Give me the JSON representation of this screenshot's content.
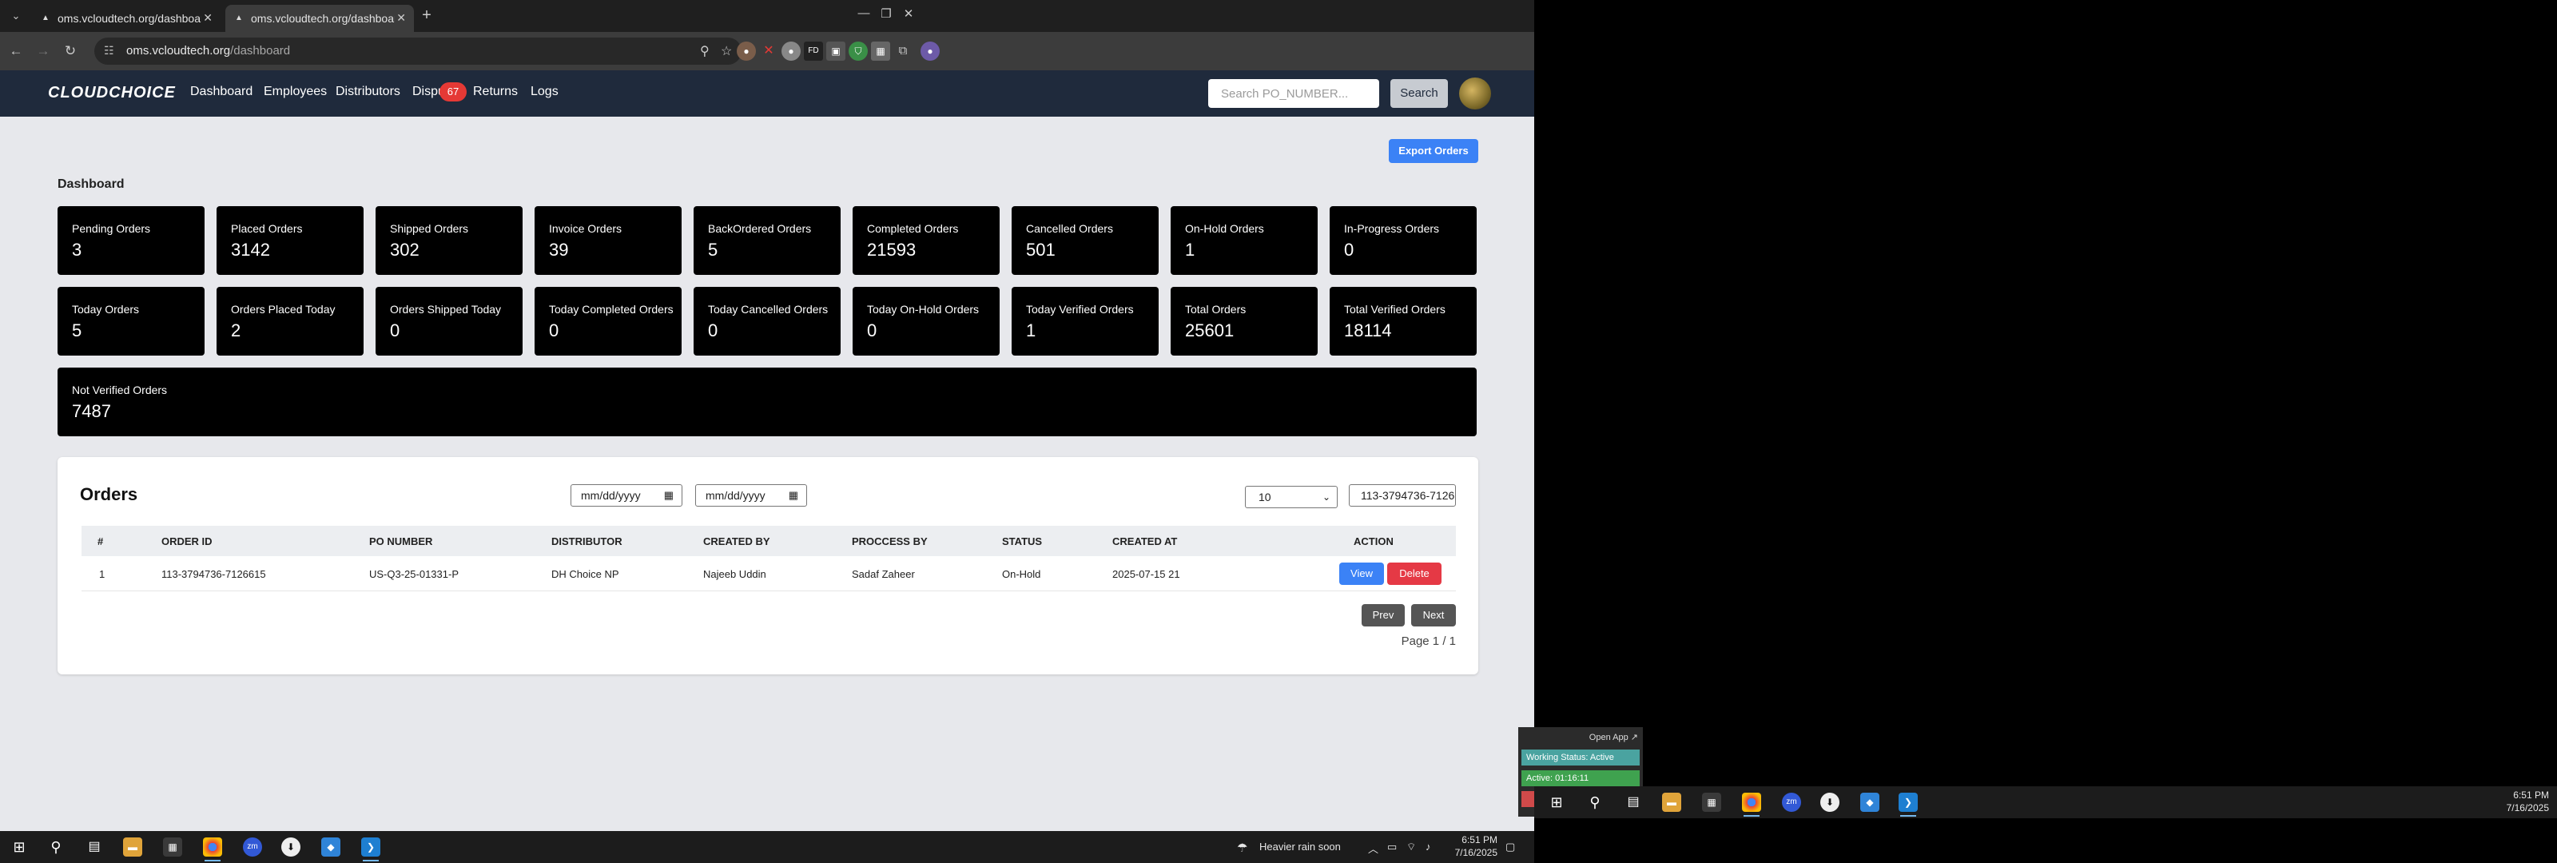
{
  "browser": {
    "tabs": [
      {
        "title": "oms.vcloudtech.org/dashboard"
      },
      {
        "title": "oms.vcloudtech.org/dashboard"
      }
    ],
    "url_host": "oms.vcloudtech.org",
    "url_path": "/dashboard"
  },
  "app": {
    "logo": "CLOUDCHOICE",
    "nav": [
      "Dashboard",
      "Employees",
      "Distributors",
      "Disputes",
      "Returns",
      "Logs"
    ],
    "disputes_badge": "67",
    "search_placeholder": "Search PO_NUMBER...",
    "search_button": "Search",
    "export_button": "Export Orders",
    "dashboard_title": "Dashboard"
  },
  "stats": [
    {
      "label": "Pending Orders",
      "value": "3"
    },
    {
      "label": "Placed Orders",
      "value": "3142"
    },
    {
      "label": "Shipped Orders",
      "value": "302"
    },
    {
      "label": "Invoice Orders",
      "value": "39"
    },
    {
      "label": "BackOrdered Orders",
      "value": "5"
    },
    {
      "label": "Completed Orders",
      "value": "21593"
    },
    {
      "label": "Cancelled Orders",
      "value": "501"
    },
    {
      "label": "On-Hold Orders",
      "value": "1"
    },
    {
      "label": "In-Progress Orders",
      "value": "0"
    },
    {
      "label": "Today Orders",
      "value": "5"
    },
    {
      "label": "Orders Placed Today",
      "value": "2"
    },
    {
      "label": "Orders Shipped Today",
      "value": "0"
    },
    {
      "label": "Today Completed Orders",
      "value": "0"
    },
    {
      "label": "Today Cancelled Orders",
      "value": "0"
    },
    {
      "label": "Today On-Hold Orders",
      "value": "0"
    },
    {
      "label": "Today Verified Orders",
      "value": "1"
    },
    {
      "label": "Total Orders",
      "value": "25601"
    },
    {
      "label": "Total Verified Orders",
      "value": "18114"
    },
    {
      "label": "Not Verified Orders",
      "value": "7487"
    }
  ],
  "orders": {
    "title": "Orders",
    "date_placeholder": "mm/dd/yyyy",
    "page_size": "10",
    "po_filter": "113-3794736-7126",
    "columns": [
      "#",
      "ORDER ID",
      "PO NUMBER",
      "DISTRIBUTOR",
      "CREATED BY",
      "PROCCESS BY",
      "STATUS",
      "CREATED AT",
      "ACTION"
    ],
    "rows": [
      {
        "num": "1",
        "order_id": "113-3794736-7126615",
        "po_number": "US-Q3-25-01331-P",
        "distributor": "DH Choice NP",
        "created_by": "Najeeb Uddin",
        "process_by": "Sadaf Zaheer",
        "status": "On-Hold",
        "created_at": "2025-07-15 21"
      }
    ],
    "view_button": "View",
    "delete_button": "Delete",
    "prev_button": "Prev",
    "next_button": "Next",
    "page_info": "Page 1 / 1"
  },
  "taskbar": {
    "weather": "Heavier rain soon",
    "time": "6:51 PM",
    "date": "7/16/2025"
  },
  "monitor2": {
    "open_app": "Open App ↗",
    "working_status": "Working Status: Active",
    "active_timer": "Active: 01:16:11",
    "time": "6:51 PM",
    "date": "7/16/2025"
  }
}
